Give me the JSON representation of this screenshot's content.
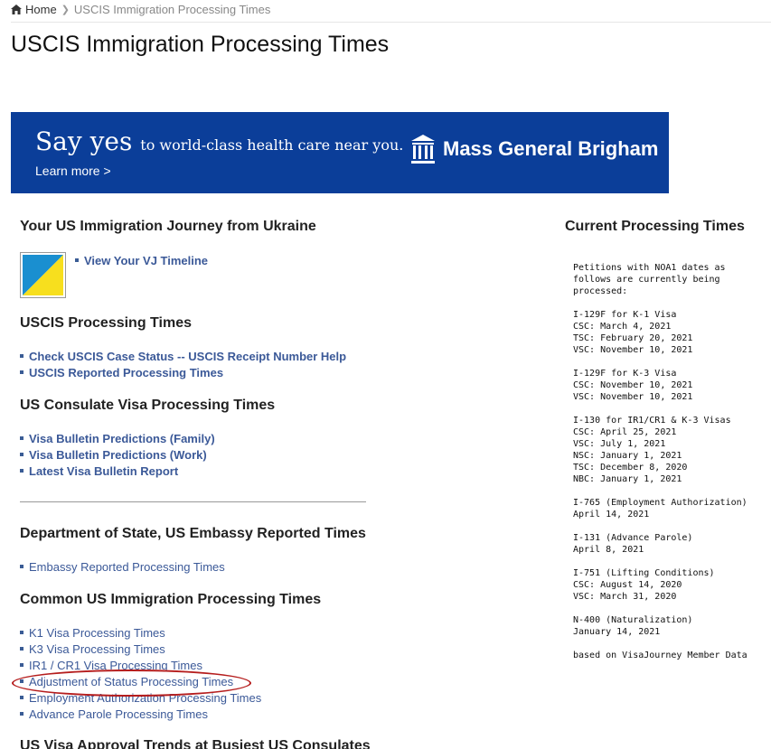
{
  "breadcrumb": {
    "home": "Home",
    "current": "USCIS Immigration Processing Times"
  },
  "page_title": "USCIS Immigration Processing Times",
  "banner": {
    "say_yes": "Say yes",
    "tagline": "to world-class health care near you.",
    "learn_more": "Learn more >",
    "brand": "Mass General Brigham",
    "bg_color": "#0b3e99"
  },
  "journey": {
    "heading": "Your US Immigration Journey from Ukraine",
    "link": "View Your VJ Timeline",
    "flag_colors": [
      "#1a8fd0",
      "#f7df1e"
    ]
  },
  "uscis": {
    "heading": "USCIS Processing Times",
    "links": [
      "Check USCIS Case Status -- USCIS Receipt Number Help",
      "USCIS Reported Processing Times"
    ]
  },
  "consulate": {
    "heading": "US Consulate Visa Processing Times",
    "links": [
      "Visa Bulletin Predictions (Family)",
      "Visa Bulletin Predictions (Work)",
      "Latest Visa Bulletin Report"
    ]
  },
  "dos": {
    "heading": "Department of State, US Embassy Reported Times",
    "links": [
      "Embassy Reported Processing Times"
    ]
  },
  "common": {
    "heading": "Common US Immigration Processing Times",
    "links": [
      "K1 Visa Processing Times",
      "K3 Visa Processing Times",
      "IR1 / CR1 Visa Processing Times",
      "Adjustment of Status Processing Times",
      "Employment Authorization Processing Times",
      "Advance Parole Processing Times"
    ],
    "highlight_color": "#b51d1d"
  },
  "trends_heading": "US Visa Approval Trends at Busiest US Consulates",
  "right": {
    "title": "Current Processing Times",
    "intro": [
      "Petitions with NOA1 dates as",
      "follows are currently being",
      "processed:"
    ],
    "blocks": [
      [
        "I-129F for K-1 Visa",
        "CSC: March 4, 2021",
        "TSC: February 20, 2021",
        "VSC: November 10, 2021"
      ],
      [
        "I-129F for K-3 Visa",
        "CSC: November 10, 2021",
        "VSC: November 10, 2021"
      ],
      [
        "I-130 for IR1/CR1 & K-3 Visas",
        "CSC: April 25, 2021",
        "VSC: July 1, 2021",
        "NSC: January 1, 2021",
        "TSC: December 8, 2020",
        "NBC: January 1, 2021"
      ],
      [
        "I-765 (Employment Authorization)",
        "April 14, 2021"
      ],
      [
        "I-131 (Advance Parole)",
        "April 8, 2021"
      ],
      [
        "I-751 (Lifting Conditions)",
        "CSC: August 14, 2020",
        "VSC: March 31, 2020"
      ],
      [
        "N-400 (Naturalization)",
        "January 14, 2021"
      ]
    ],
    "footer": "based on VisaJourney Member Data"
  }
}
